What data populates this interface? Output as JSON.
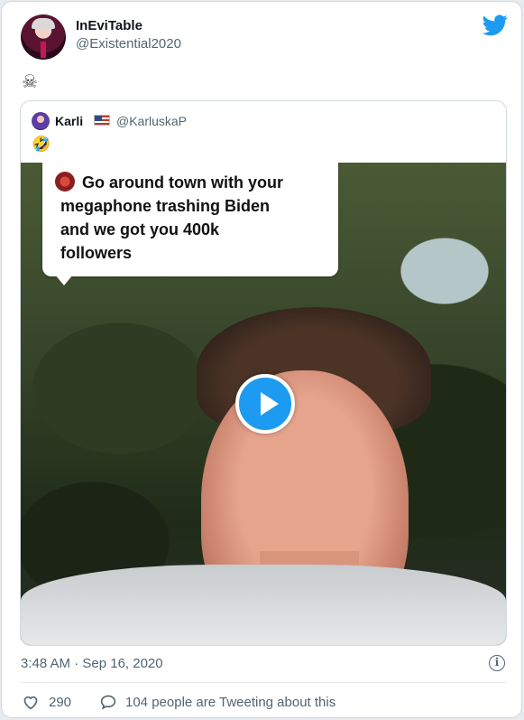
{
  "tweet": {
    "display_name": "InEviTable",
    "handle": "@Existential2020",
    "body_emoji": "☠",
    "timestamp": "3:48 AM · Sep 16, 2020",
    "likes": "290",
    "tweeting_text": "104 people are Tweeting about this",
    "brand_color": "#1d9bf0"
  },
  "quoted_tweet": {
    "display_name": "Karli",
    "flag": "US flag",
    "handle": "@KarluskaP",
    "body_emoji": "🤣",
    "video": {
      "caption_lines": [
        "Go around town with your",
        "megaphone trashing Biden",
        "and we got you 400k",
        "followers"
      ]
    }
  },
  "icons": {
    "brand": "twitter-bird-icon",
    "play": "play-icon",
    "info": "info-icon",
    "like": "heart-icon",
    "reply": "speech-bubble-icon"
  },
  "info_glyph": "i"
}
